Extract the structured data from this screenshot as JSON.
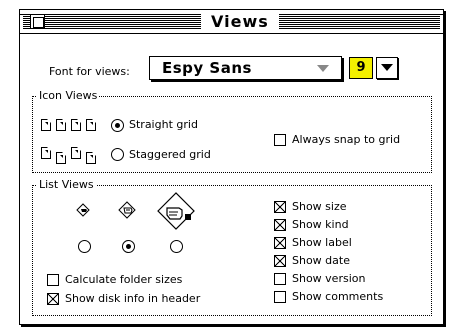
{
  "window": {
    "title": "Views"
  },
  "font": {
    "label": "Font for views:",
    "value": "Espy Sans",
    "size": "9"
  },
  "icon_views": {
    "title": "Icon Views",
    "straight_grid": "Straight grid",
    "staggered_grid": "Staggered grid",
    "selected": "straight_grid",
    "always_snap": "Always snap to grid",
    "always_snap_checked": false
  },
  "list_views": {
    "title": "List Views",
    "icon_size_selected": 2,
    "options_left": [
      {
        "label": "Calculate folder sizes",
        "checked": false
      },
      {
        "label": "Show disk info in header",
        "checked": true
      }
    ],
    "options_right": [
      {
        "label": "Show size",
        "checked": true
      },
      {
        "label": "Show kind",
        "checked": true
      },
      {
        "label": "Show label",
        "checked": true
      },
      {
        "label": "Show date",
        "checked": true
      },
      {
        "label": "Show version",
        "checked": false
      },
      {
        "label": "Show comments",
        "checked": false
      }
    ]
  },
  "colors": {
    "size_field_bg": "#f4f000"
  }
}
